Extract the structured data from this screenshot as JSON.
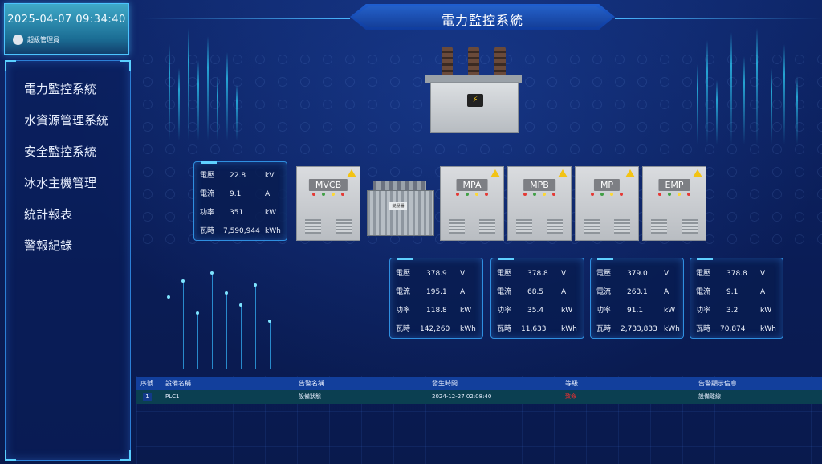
{
  "header": {
    "datetime": "2025-04-07 09:34:40",
    "user": "超級管理員",
    "title": "電力監控系統"
  },
  "sidebar": {
    "items": [
      {
        "label": "電力監控系統"
      },
      {
        "label": "水資源管理系統"
      },
      {
        "label": "安全監控系統"
      },
      {
        "label": "冰水主機管理"
      },
      {
        "label": "統計報表"
      },
      {
        "label": "警報紀錄"
      }
    ]
  },
  "main_meter": {
    "rows": [
      {
        "label": "電壓",
        "value": "22.8",
        "unit": "kV"
      },
      {
        "label": "電流",
        "value": "9.1",
        "unit": "A"
      },
      {
        "label": "功率",
        "value": "351",
        "unit": "kW"
      },
      {
        "label": "瓦時",
        "value": "7,590,944",
        "unit": "kWh"
      }
    ]
  },
  "cabinets": {
    "mvcb": "MVCB",
    "mpa": "MPA",
    "mpb": "MPB",
    "mp": "MP",
    "emp": "EMP",
    "transformer_plate": "變壓器"
  },
  "meters": [
    {
      "rows": [
        {
          "label": "電壓",
          "value": "378.9",
          "unit": "V"
        },
        {
          "label": "電流",
          "value": "195.1",
          "unit": "A"
        },
        {
          "label": "功率",
          "value": "118.8",
          "unit": "kW"
        },
        {
          "label": "瓦時",
          "value": "142,260",
          "unit": "kWh"
        }
      ]
    },
    {
      "rows": [
        {
          "label": "電壓",
          "value": "378.8",
          "unit": "V"
        },
        {
          "label": "電流",
          "value": "68.5",
          "unit": "A"
        },
        {
          "label": "功率",
          "value": "35.4",
          "unit": "kW"
        },
        {
          "label": "瓦時",
          "value": "11,633",
          "unit": "kWh"
        }
      ]
    },
    {
      "rows": [
        {
          "label": "電壓",
          "value": "379.0",
          "unit": "V"
        },
        {
          "label": "電流",
          "value": "263.1",
          "unit": "A"
        },
        {
          "label": "功率",
          "value": "91.1",
          "unit": "kW"
        },
        {
          "label": "瓦時",
          "value": "2,733,833",
          "unit": "kWh"
        }
      ]
    },
    {
      "rows": [
        {
          "label": "電壓",
          "value": "378.8",
          "unit": "V"
        },
        {
          "label": "電流",
          "value": "9.1",
          "unit": "A"
        },
        {
          "label": "功率",
          "value": "3.2",
          "unit": "kW"
        },
        {
          "label": "瓦時",
          "value": "70,874",
          "unit": "kWh"
        }
      ]
    }
  ],
  "alarm_table": {
    "headers": [
      "序號",
      "設備名稱",
      "告警名稱",
      "發生時間",
      "等級",
      "告警顯示信息"
    ],
    "rows": [
      {
        "index": "1",
        "device": "PLC1",
        "alarm": "設備狀態",
        "time": "2024-12-27 02:08:40",
        "level": "致命",
        "message": "設備離線"
      }
    ]
  },
  "colors": {
    "background": "#0b1f5c",
    "accent": "#4cc4ff",
    "alarm_level": "#ff2d2d",
    "led_red": "#e53935",
    "led_green": "#43a047",
    "led_yellow": "#fdd835"
  },
  "icons": [
    "user-avatar-icon",
    "lightning-icon",
    "warning-icon"
  ]
}
